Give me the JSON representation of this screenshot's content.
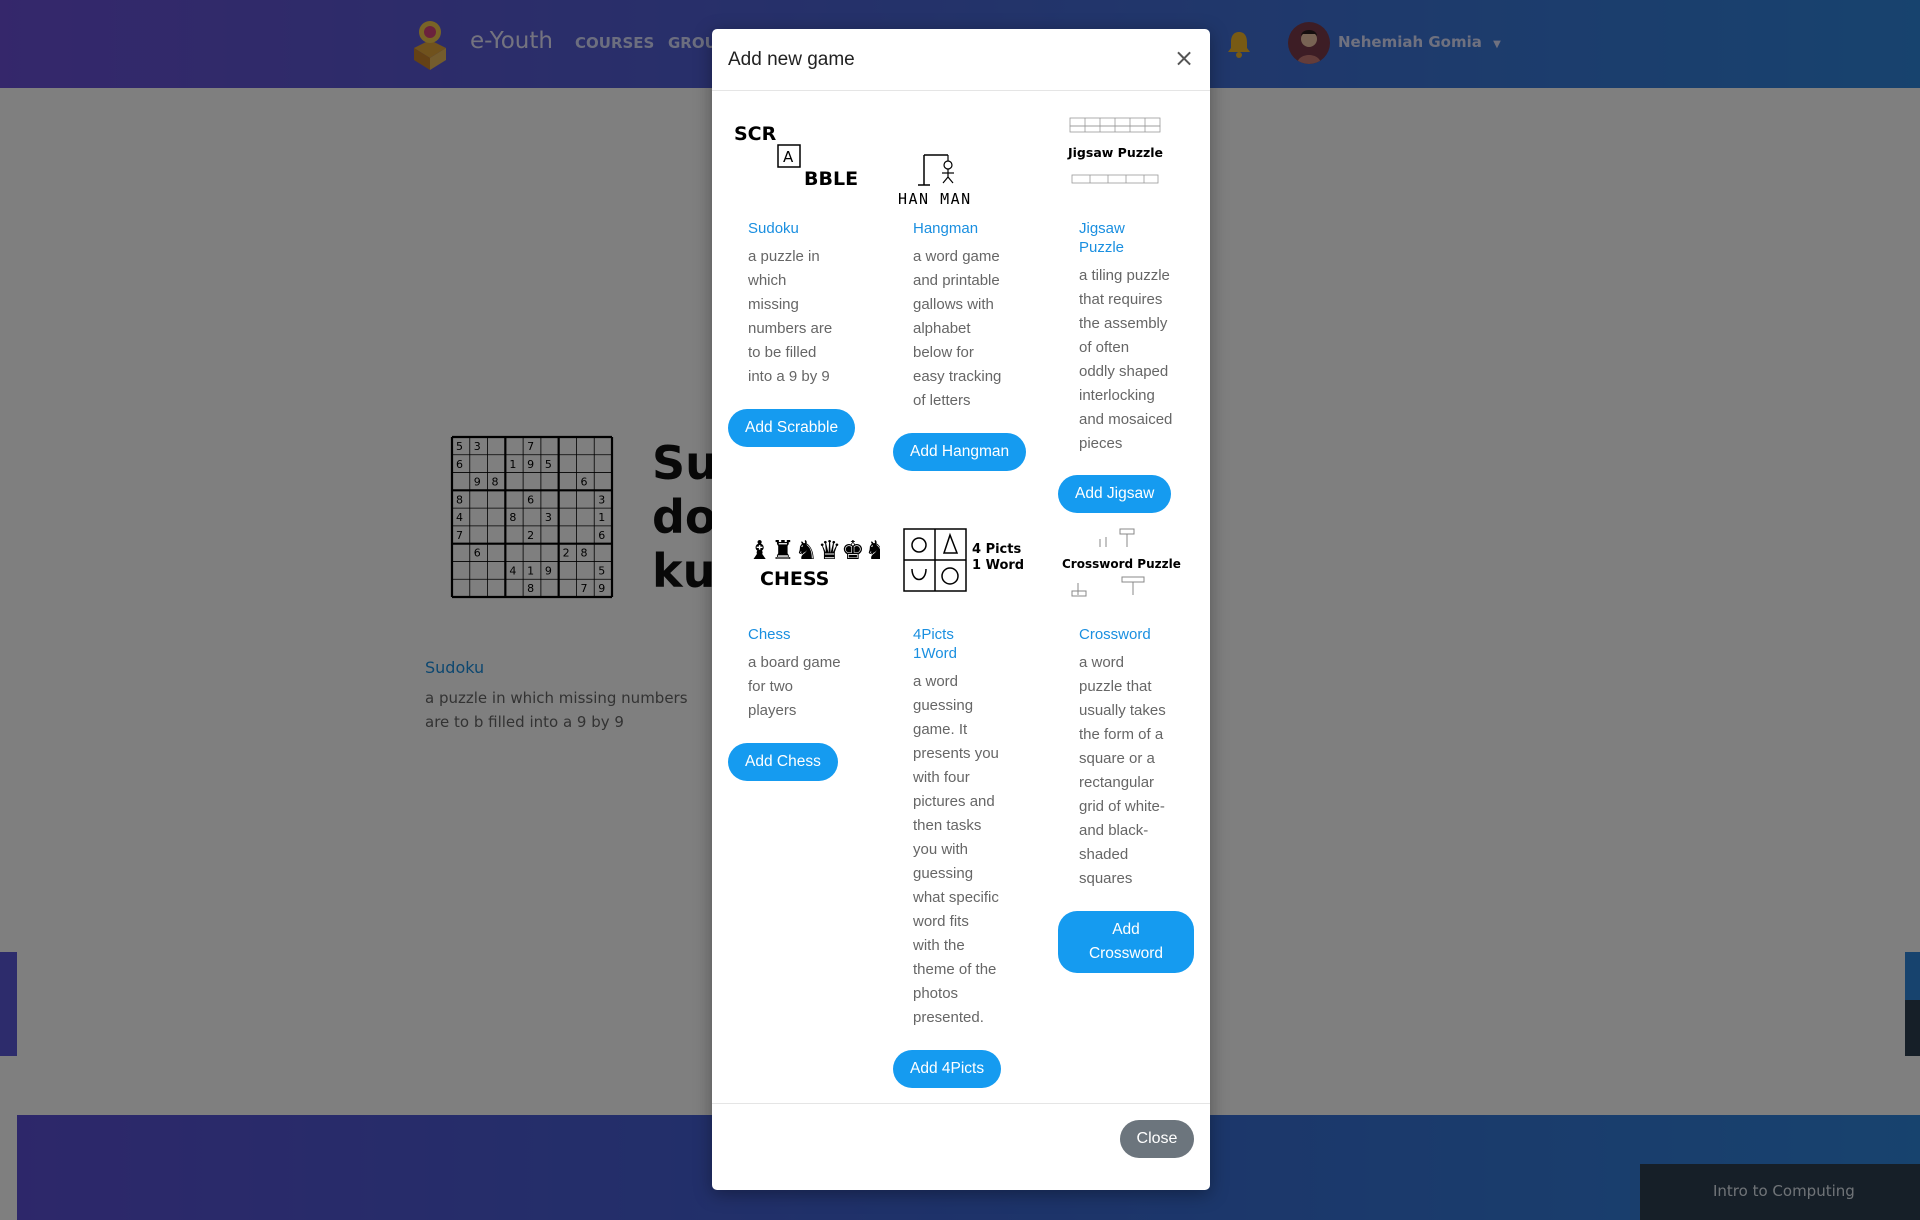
{
  "header": {
    "brand": "e-Youth",
    "nav": [
      "COURSES",
      "GROU"
    ],
    "user": "Nehemiah Gomia"
  },
  "background": {
    "card_big_text": "Su do ku",
    "card_title": "Sudoku",
    "card_desc": "a puzzle in which missing numbers are to b filled into a 9 by 9",
    "footer_chip": "Intro to Computing"
  },
  "modal": {
    "title": "Add new game",
    "close_x": "×",
    "close_label": "Close",
    "games": [
      {
        "title": "Sudoku",
        "desc": [
          "a puzzle in",
          "which",
          "missing",
          "numbers are",
          "to be filled",
          "into a 9 by 9"
        ],
        "button": "Add Scrabble",
        "image": "scrabble-logo"
      },
      {
        "title": "Hangman",
        "desc": [
          "a word game",
          "and printable",
          "gallows with",
          "alphabet",
          "below for",
          "easy tracking",
          "of letters"
        ],
        "button": "Add Hangman",
        "image": "hangman-logo"
      },
      {
        "title": [
          "Jigsaw",
          "Puzzle"
        ],
        "desc": [
          "a tiling puzzle",
          "that requires",
          "the assembly",
          "of often",
          "oddly shaped",
          "interlocking",
          "and mosaiced",
          "pieces"
        ],
        "button": "Add Jigsaw",
        "image": "jigsaw-logo"
      },
      {
        "title": "Chess",
        "desc": [
          "a board game",
          "for two",
          "players"
        ],
        "button": "Add Chess",
        "image": "chess-logo"
      },
      {
        "title": [
          "4Picts",
          "1Word"
        ],
        "desc": [
          "a word",
          "guessing",
          "game. It",
          "presents you",
          "with four",
          "pictures and",
          "then tasks",
          "you with",
          "guessing",
          "what specific",
          "word fits",
          "with the",
          "theme of the",
          "photos",
          "presented."
        ],
        "button": "Add 4Picts",
        "image": "four-picts-logo"
      },
      {
        "title": "Crossword",
        "desc": [
          "a word",
          "puzzle that",
          "usually takes",
          "the form of a",
          "square or a",
          "rectangular",
          "grid of white-",
          "and black-",
          "shaded",
          "squares"
        ],
        "button": [
          "Add",
          "Crossword"
        ],
        "image": "crossword-logo"
      }
    ],
    "image_text": {
      "scrabble_top": "SCR",
      "scrabble_tile": "A",
      "scrabble_bottom": "BBLE",
      "hangman": "HAN_MAN",
      "jigsaw": "Jigsaw  Puzzle",
      "chess_pieces": "♝♜♞♛♚♞♜♝",
      "chess": "CHESS",
      "four_picts_1": "4 Picts",
      "four_picts_2": "1 Word",
      "crossword": "Crossword Puzzle"
    }
  },
  "sudoku_grid": [
    "53  7    ",
    "6  195   ",
    " 98    6 ",
    "8   6   3",
    "4  8 3  1",
    "7   2   6",
    " 6    28 ",
    "   419  5",
    "    8  79"
  ],
  "colors": {
    "accent": "#159bf0",
    "link": "#1a8fe0",
    "close_button": "#6c757d",
    "nav_gradient_start": "#6a4fd6",
    "nav_gradient_end": "#2f86dd"
  }
}
